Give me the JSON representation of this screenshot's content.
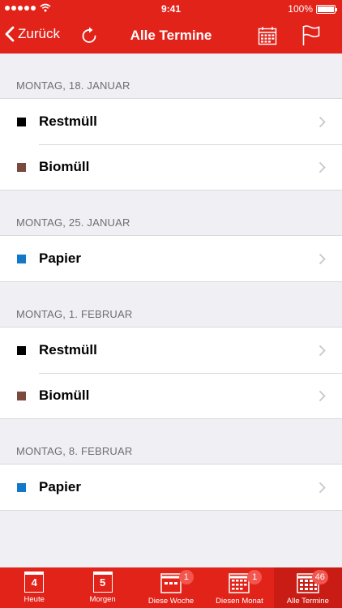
{
  "status": {
    "time": "9:41",
    "battery": "100%"
  },
  "nav": {
    "back_label": "Zurück",
    "title": "Alle Termine"
  },
  "sections": [
    {
      "header": "Montag, 18. Januar",
      "items": [
        {
          "label": "Restmüll",
          "color": "#000000"
        },
        {
          "label": "Biomüll",
          "color": "#7b4a3e"
        }
      ]
    },
    {
      "header": "Montag, 25. Januar",
      "items": [
        {
          "label": "Papier",
          "color": "#1478c8"
        }
      ]
    },
    {
      "header": "Montag, 1. Februar",
      "items": [
        {
          "label": "Restmüll",
          "color": "#000000"
        },
        {
          "label": "Biomüll",
          "color": "#7b4a3e"
        }
      ]
    },
    {
      "header": "Montag, 8. Februar",
      "items": [
        {
          "label": "Papier",
          "color": "#1478c8"
        }
      ]
    }
  ],
  "tabs": [
    {
      "label": "Heute",
      "day": "4"
    },
    {
      "label": "Morgen",
      "day": "5"
    },
    {
      "label": "Diese Woche",
      "badge": "1"
    },
    {
      "label": "Diesen Monat",
      "badge": "1"
    },
    {
      "label": "Alle Termine",
      "badge": "46"
    }
  ],
  "colors": {
    "brand": "#e2231a",
    "background": "#efeff4"
  }
}
